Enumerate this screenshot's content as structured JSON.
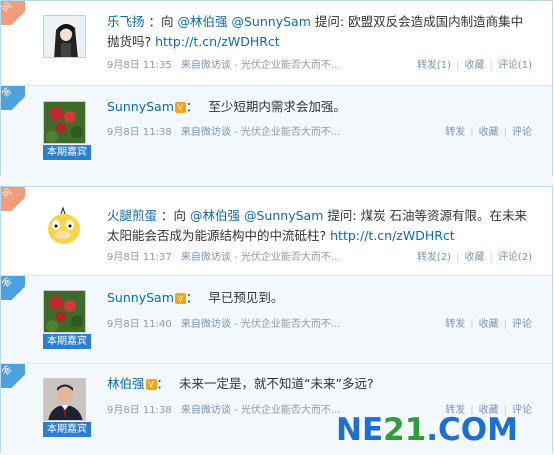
{
  "threads": [
    {
      "question": {
        "ribbon": "问",
        "author": "乐飞扬",
        "prefix": "：向",
        "mention1": "@林伯强",
        "mention2": "@SunnySam",
        "verb": "提问:",
        "body": "欧盟双反会造成国内制造商集中抛货吗?",
        "link": "http://t.cn/zWDHRct",
        "date": "9月8日 11:35",
        "from": "来自微访谈",
        "topic": "- 光伏企业能否大而不...",
        "forward": "转发(1)",
        "favorite": "收藏",
        "comment": "评论(1)"
      },
      "answer": {
        "ribbon": "答",
        "author": "SunnySam",
        "vbadge": "V",
        "body": "至少短期内需求会加强。",
        "badge": "本期嘉宾",
        "date": "9月8日 11:38",
        "from": "来自微访谈",
        "topic": "- 光伏企业能否大而不...",
        "forward": "转发",
        "favorite": "收藏",
        "comment": "评论"
      }
    },
    {
      "question": {
        "ribbon": "问",
        "author": "火腿煎蛋",
        "prefix": "：向",
        "mention1": "@林伯强",
        "mention2": "@SunnySam",
        "verb": "提问:",
        "body": "煤炭 石油等资源有限。在未来太阳能会否成为能源结构中的中流砥柱?",
        "link": "http://t.cn/zWDHRct",
        "date": "9月8日 11:37",
        "from": "来自微访谈",
        "topic": "- 光伏企业能否大而不...",
        "forward": "转发(2)",
        "favorite": "收藏",
        "comment": "评论(2)"
      },
      "answers": [
        {
          "ribbon": "答",
          "author": "SunnySam",
          "vbadge": "V",
          "body": "早已预见到。",
          "badge": "本期嘉宾",
          "date": "9月8日 11:40",
          "from": "来自微访谈",
          "topic": "- 光伏企业能否大而不...",
          "forward": "转发",
          "favorite": "收藏",
          "comment": "评论"
        },
        {
          "ribbon": "答",
          "author": "林伯强",
          "vbadge": "V",
          "body": "未来一定是，就不知道“未来”多远?",
          "badge": "本期嘉宾",
          "date": "9月8日 11:38",
          "from": "来自微访谈",
          "topic": "- 光伏企业能否大而不...",
          "forward": "转发",
          "favorite": "收藏",
          "comment": "评论"
        }
      ]
    }
  ],
  "watermark": {
    "ne": "NE",
    "num": "21",
    "com": ".COM"
  },
  "colors": {
    "link": "#0a6ab8",
    "question_ribbon": "#f29c7e",
    "answer_ribbon": "#4ca1de",
    "badge": "#2b7fcf"
  }
}
